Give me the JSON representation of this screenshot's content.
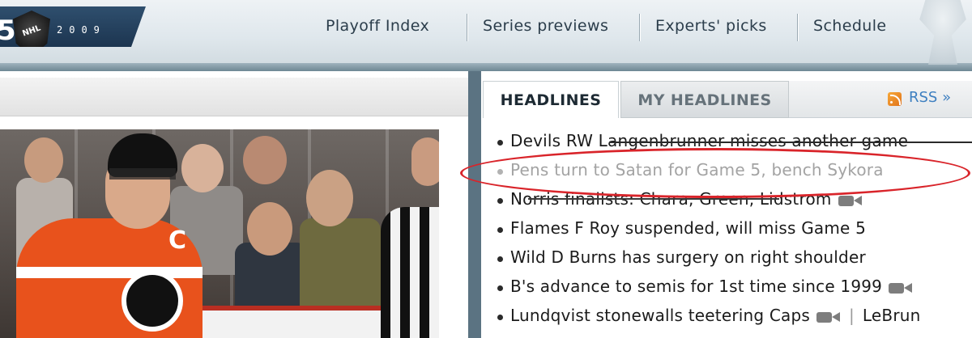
{
  "header": {
    "logo_year": "2009",
    "logo_digit": "5",
    "nhl_mark": "NHL",
    "nav": [
      {
        "label": "Playoff Index"
      },
      {
        "label": "Series previews"
      },
      {
        "label": "Experts' picks"
      },
      {
        "label": "Schedule"
      }
    ]
  },
  "module": {
    "tabs": [
      {
        "label": "HEADLINES",
        "active": true
      },
      {
        "label": "MY HEADLINES",
        "active": false
      }
    ],
    "rss_label": "RSS »",
    "rss_icon": "rss-icon",
    "headlines": [
      {
        "text": "Devils RW Langenbrunner misses another game",
        "video": false,
        "faded": false,
        "struck": true
      },
      {
        "text": "Pens turn to Satan for Game 5, bench Sykora",
        "video": false,
        "faded": true,
        "highlighted": true
      },
      {
        "text": "Norris finalists: Chara, Green, Lidstrom",
        "video": true,
        "faded": false,
        "struck_partial": true
      },
      {
        "text": "Flames F Roy suspended, will miss Game 5",
        "video": false,
        "faded": false
      },
      {
        "text": "Wild D Burns has surgery on right shoulder",
        "video": false,
        "faded": false
      },
      {
        "text": "B's advance to semis for 1st time since 1999",
        "video": true,
        "faded": false
      },
      {
        "text": "Lundqvist stonewalls teetering Caps",
        "video": true,
        "faded": false,
        "trailing": "LeBrun"
      }
    ]
  },
  "colors": {
    "highlight_ring": "#d9242a",
    "link": "#3d7fc0",
    "nav_text": "#2b3d4b"
  }
}
